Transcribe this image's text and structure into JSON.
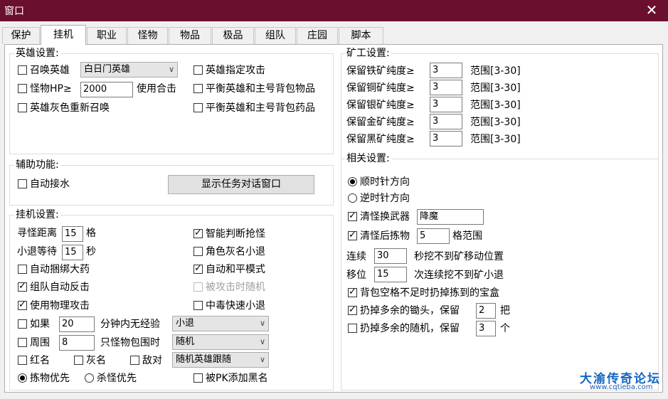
{
  "window": {
    "title": "窗口",
    "close_glyph": "✕",
    "colors": {
      "titlebar": "#6b0f2e",
      "watermark": "#1565c0"
    }
  },
  "tabs": [
    {
      "label": "保护",
      "active": false
    },
    {
      "label": "挂机",
      "active": true
    },
    {
      "label": "职业",
      "active": false
    },
    {
      "label": "怪物",
      "active": false
    },
    {
      "label": "物品",
      "active": false
    },
    {
      "label": "极品",
      "active": false
    },
    {
      "label": "组队",
      "active": false
    },
    {
      "label": "庄园",
      "active": false
    },
    {
      "label": "脚本",
      "active": false
    }
  ],
  "hero": {
    "title": "英雄设置:",
    "summon_label": "召唤英雄",
    "summon_checked": false,
    "hero_type": "白日门英雄",
    "monster_hp_label": "怪物HP≥",
    "monster_hp_checked": false,
    "monster_hp_value": "2000",
    "combo_label": "使用合击",
    "gray_resummon_label": "英雄灰色重新召唤",
    "gray_resummon_checked": false,
    "designated_attack_label": "英雄指定攻击",
    "designated_attack_checked": false,
    "balance_items_label": "平衡英雄和主号背包物品",
    "balance_items_checked": false,
    "balance_potions_label": "平衡英雄和主号背包药品",
    "balance_potions_checked": false
  },
  "aux": {
    "title": "辅助功能:",
    "auto_water_label": "自动接水",
    "auto_water_checked": false,
    "show_task_button": "显示任务对话窗口"
  },
  "idle": {
    "title": "挂机设置:",
    "search_dist_label": "寻怪距离",
    "search_dist_value": "15",
    "search_dist_unit": "格",
    "retreat_wait_label": "小退等待",
    "retreat_wait_value": "15",
    "retreat_wait_unit": "秒",
    "auto_bind_label": "自动捆绑大药",
    "auto_bind_checked": false,
    "team_counter_label": "组队自动反击",
    "team_counter_checked": true,
    "physical_attack_label": "使用物理攻击",
    "physical_attack_checked": true,
    "smart_grab_label": "智能判断抢怪",
    "smart_grab_checked": true,
    "gray_name_retreat_label": "角色灰名小退",
    "gray_name_retreat_checked": false,
    "auto_peace_label": "自动和平模式",
    "auto_peace_checked": true,
    "random_when_attacked_label": "被攻击时随机",
    "random_when_attacked_checked": false,
    "poison_retreat_label": "中毒快速小退",
    "poison_retreat_checked": false,
    "if_label": "如果",
    "if_checked": false,
    "if_value": "20",
    "if_suffix": "分钟内无经验",
    "if_action": "小退",
    "surround_label": "周围",
    "surround_checked": false,
    "surround_value": "8",
    "surround_suffix": "只怪物包围时",
    "surround_action": "随机",
    "red_name_label": "红名",
    "red_name_checked": false,
    "gray_name_label": "灰名",
    "gray_name_checked": false,
    "enemy_label": "敌对",
    "enemy_checked": false,
    "enemy_action": "随机英雄跟随",
    "pick_first_label": "拣物优先",
    "pick_first_selected": true,
    "kill_first_label": "杀怪优先",
    "kill_first_selected": false,
    "pk_blacklist_label": "被PK添加黑名",
    "pk_blacklist_checked": false
  },
  "mining": {
    "title": "矿工设置:",
    "rows": [
      {
        "label": "保留铁矿纯度≥",
        "value": "3",
        "range": "范围[3-30]"
      },
      {
        "label": "保留铜矿纯度≥",
        "value": "3",
        "range": "范围[3-30]"
      },
      {
        "label": "保留银矿纯度≥",
        "value": "3",
        "range": "范围[3-30]"
      },
      {
        "label": "保留金矿纯度≥",
        "value": "3",
        "range": "范围[3-30]"
      },
      {
        "label": "保留黑矿纯度≥",
        "value": "3",
        "range": "范围[3-30]"
      }
    ]
  },
  "related": {
    "title": "相关设置:",
    "clockwise_label": "顺时针方向",
    "clockwise_selected": true,
    "counter_label": "逆时针方向",
    "counter_selected": false,
    "swap_weapon_label": "清怪换武器",
    "swap_weapon_checked": true,
    "swap_weapon_value": "降魔",
    "pickup_label": "清怪后拣物",
    "pickup_checked": true,
    "pickup_value": "5",
    "pickup_suffix": "格范围",
    "continuous_label": "连续",
    "continuous_value": "30",
    "continuous_suffix": "秒挖不到矿移动位置",
    "move_label": "移位",
    "move_value": "15",
    "move_suffix": "次连续挖不到矿小退",
    "bag_full_label": "背包空格不足时扔掉拣到的宝盒",
    "bag_full_checked": true,
    "drop_pickaxe_label": "扔掉多余的锄头，保留",
    "drop_pickaxe_checked": true,
    "drop_pickaxe_value": "2",
    "drop_pickaxe_unit": "把",
    "drop_random_label": "扔掉多余的随机，保留",
    "drop_random_checked": false,
    "drop_random_value": "3",
    "drop_random_unit": "个"
  },
  "watermark": {
    "logo_text": "大渝传奇论坛",
    "url": "www.cqtieba.com"
  }
}
